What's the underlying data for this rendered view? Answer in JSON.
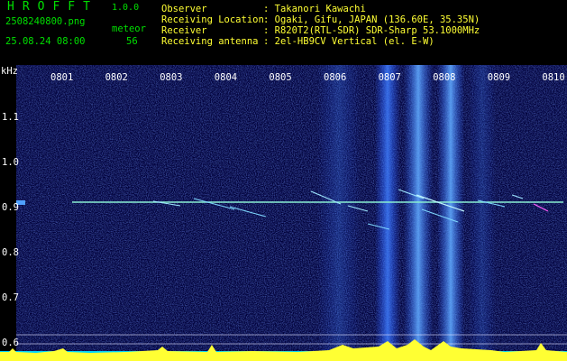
{
  "header": {
    "app_name": "HROFFT",
    "version": "1.0.0",
    "filename": "2508240800.png",
    "meteor_label": "meteor",
    "datetime": "25.08.24 08:00",
    "meteor_count": "56",
    "info_labels": "Observer\nReceiving Location\nReceiver\nReceiving antenna",
    "info_values": ": Takanori Kawachi\n: Ogaki, Gifu, JAPAN (136.60E, 35.35N)\n: R820T2(RTL-SDR) SDR-Sharp 53.1000MHz\n: 2el-HB9CV Vertical (el. E-W)"
  },
  "axis": {
    "unit": "kHz",
    "time_ticks": [
      "0801",
      "0802",
      "0803",
      "0804",
      "0805",
      "0806",
      "0807",
      "0808",
      "0809",
      "0810"
    ],
    "freq_ticks": [
      "1.1",
      "1.0",
      "0.9",
      "0.8",
      "0.7",
      "0.6"
    ]
  },
  "colors": {
    "header_text": "#00e000",
    "label_text": "#ffffff",
    "accent": "#ffff33",
    "background": "#000040",
    "noise_floor": "#00d8ff"
  }
}
